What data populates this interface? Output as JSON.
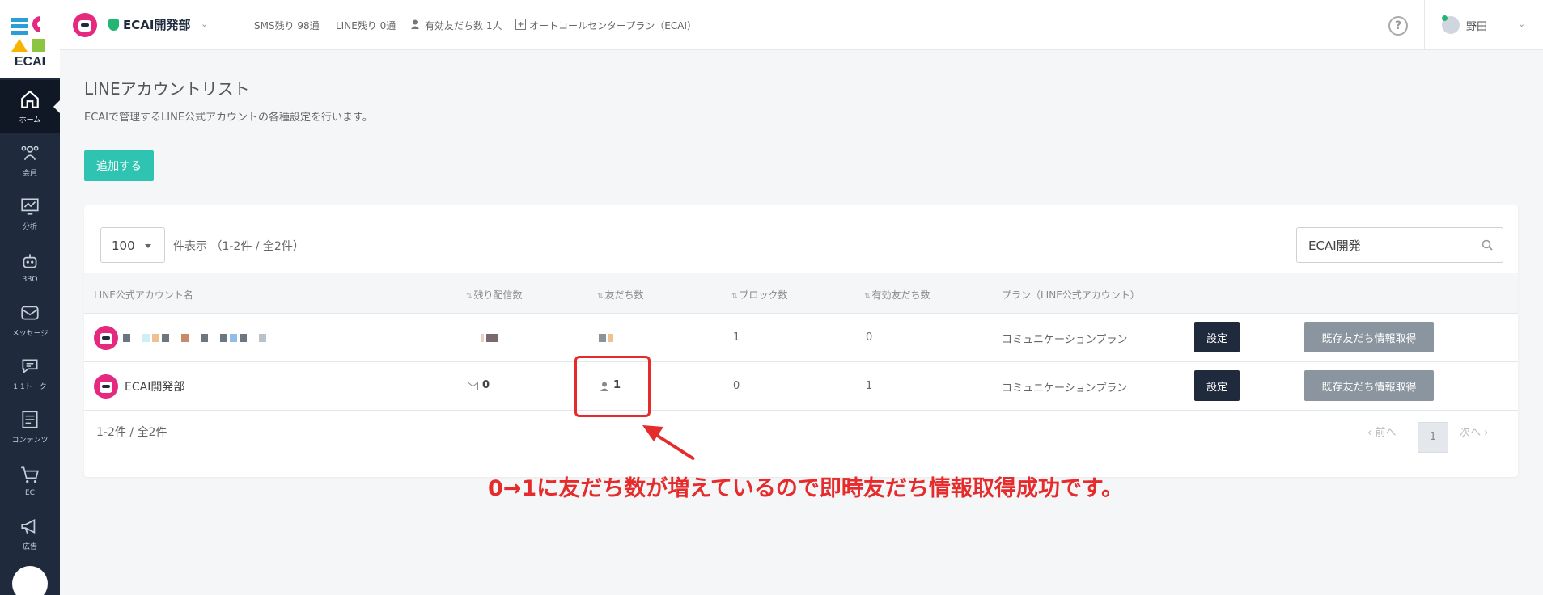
{
  "app": {
    "logo_text": "ECAI"
  },
  "sidebar": {
    "items": [
      {
        "label": "ホーム",
        "icon": "home-icon",
        "active": true
      },
      {
        "label": "会員",
        "icon": "members-icon"
      },
      {
        "label": "分析",
        "icon": "analytics-icon"
      },
      {
        "label": "3BO",
        "icon": "robot-icon"
      },
      {
        "label": "メッセージ",
        "icon": "message-icon"
      },
      {
        "label": "1:1トーク",
        "icon": "chat-icon"
      },
      {
        "label": "コンテンツ",
        "icon": "content-icon"
      },
      {
        "label": "EC",
        "icon": "cart-icon"
      },
      {
        "label": "広告",
        "icon": "megaphone-icon"
      }
    ]
  },
  "header": {
    "org_name": "ECAI開発部",
    "sms_remaining": "SMS残り 98通",
    "line_remaining": "LINE残り 0通",
    "valid_friends": "有効友だち数 1人",
    "plan": "オートコールセンタープラン（ECAI）",
    "user_name": "野田"
  },
  "page": {
    "title": "LINEアカウントリスト",
    "description": "ECAIで管理するLINE公式アカウントの各種設定を行います。",
    "add_button": "追加する"
  },
  "table": {
    "page_size": "100",
    "count_text": "件表示 （1-2件 / 全2件）",
    "search_value": "ECAI開発",
    "columns": {
      "account_name": "LINE公式アカウント名",
      "remaining": "残り配信数",
      "friends": "友だち数",
      "blocks": "ブロック数",
      "valid_friends": "有効友だち数",
      "plan": "プラン（LINE公式アカウント）"
    },
    "rows": [
      {
        "name": "",
        "remaining": "",
        "friends": "",
        "blocks": "1",
        "valid_friends": "0",
        "plan": "コミュニケーションプラン",
        "setting": "設定",
        "fetch": "既存友だち情報取得"
      },
      {
        "name": "ECAI開発部",
        "remaining": "0",
        "friends": "1",
        "blocks": "0",
        "valid_friends": "1",
        "plan": "コミュニケーションプラン",
        "setting": "設定",
        "fetch": "既存友だち情報取得"
      }
    ],
    "footer_count": "1-2件 / 全2件",
    "prev": "‹ 前へ",
    "page": "1",
    "next": "次へ ›"
  },
  "annotation": {
    "text": "0→1に友だち数が増えているので即時友だち情報取得成功です。",
    "color": "#e52b2b"
  },
  "colors": {
    "sidebar": "#1f2a3c",
    "accent": "#2fc4b2",
    "setting_button": "#1f2a3c",
    "fetch_button": "#8a959f"
  }
}
